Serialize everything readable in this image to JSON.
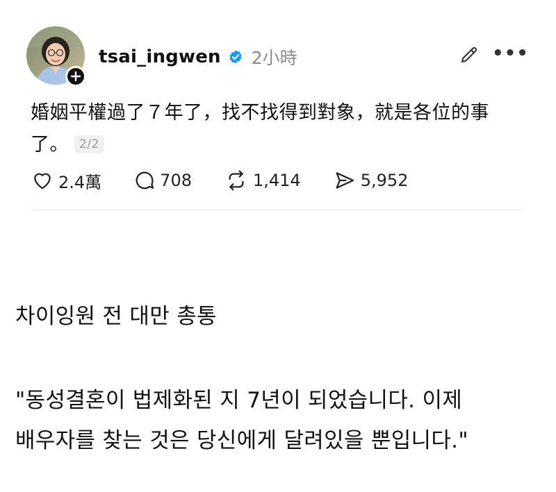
{
  "post": {
    "avatar_name": "avatar-tsai-ingwen",
    "username": "tsai_ingwen",
    "verified": true,
    "timestamp": "2小時",
    "text_line1": "婚姻平權過了７年了，找不找得到對象，就是各位的事",
    "text_line2": "了。",
    "page_indicator": "2/2",
    "stats": {
      "likes": "2.4萬",
      "replies": "708",
      "reposts": "1,414",
      "shares": "5,952"
    },
    "colors": {
      "verified_blue": "#1d9bf0",
      "text": "#111111",
      "muted": "#8a8a8a",
      "divider": "#e6e6e6"
    },
    "icons": [
      "heart-icon",
      "comment-icon",
      "repost-icon",
      "share-icon",
      "edit-icon",
      "more-icon",
      "plus-icon",
      "verified-badge-icon"
    ]
  },
  "caption": {
    "title": "차이잉원 전 대만 총통",
    "quote_line1": "\"동성결혼이 법제화된 지 7년이 되었습니다. 이제",
    "quote_line2": "배우자를 찾는 것은 당신에게 달려있을 뿐입니다.\""
  }
}
